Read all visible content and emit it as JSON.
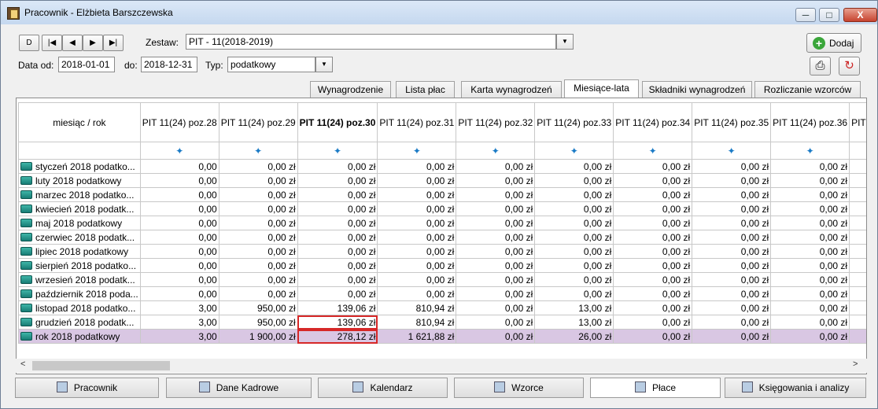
{
  "window": {
    "title": "Pracownik - Elżbieta Barszczewska",
    "minimize": "─",
    "maximize": "□",
    "close": "X"
  },
  "nav": {
    "new": "D",
    "first": "|◀",
    "prev": "◀",
    "next": "▶",
    "last": "▶|"
  },
  "form": {
    "set_label": "Zestaw:",
    "set_value": "PIT - 11(2018-2019)",
    "date_from_label": "Data od:",
    "date_from": "2018-01-01",
    "date_to_label": "do:",
    "date_to": "2018-12-31",
    "type_label": "Typ:",
    "type_value": "podatkowy",
    "dropdown_arrow": "▼"
  },
  "actions": {
    "add_label": "Dodaj",
    "add_icon": "+",
    "print_icon": "⎙",
    "refresh_icon": "↻"
  },
  "tabs": [
    "Wynagrodzenie",
    "Lista płac",
    "Karta wynagrodzeń",
    "Miesiące-lata",
    "Składniki wynagrodzeń",
    "Rozliczanie wzorców"
  ],
  "active_tab": "Miesiące-lata",
  "grid": {
    "first_header": "miesiąc / rok",
    "columns": [
      "PIT 11(24) poz.28",
      "PIT 11(24) poz.29",
      "PIT 11(24) poz.30",
      "PIT 11(24) poz.31",
      "PIT 11(24) poz.32",
      "PIT 11(24) poz.33",
      "PIT 11(24) poz.34",
      "PIT 11(24) poz.35",
      "PIT 11(24) poz.36",
      "PIT"
    ],
    "config_icon": "✦",
    "rows": [
      {
        "label": "styczeń 2018 podatko...",
        "values": [
          "0,00",
          "0,00 zł",
          "0,00 zł",
          "0,00 zł",
          "0,00 zł",
          "0,00 zł",
          "0,00 zł",
          "0,00 zł",
          "0,00 zł",
          ""
        ]
      },
      {
        "label": "luty 2018 podatkowy",
        "values": [
          "0,00",
          "0,00 zł",
          "0,00 zł",
          "0,00 zł",
          "0,00 zł",
          "0,00 zł",
          "0,00 zł",
          "0,00 zł",
          "0,00 zł",
          ""
        ]
      },
      {
        "label": "marzec 2018 podatko...",
        "values": [
          "0,00",
          "0,00 zł",
          "0,00 zł",
          "0,00 zł",
          "0,00 zł",
          "0,00 zł",
          "0,00 zł",
          "0,00 zł",
          "0,00 zł",
          ""
        ]
      },
      {
        "label": "kwiecień 2018 podatk...",
        "values": [
          "0,00",
          "0,00 zł",
          "0,00 zł",
          "0,00 zł",
          "0,00 zł",
          "0,00 zł",
          "0,00 zł",
          "0,00 zł",
          "0,00 zł",
          ""
        ]
      },
      {
        "label": "maj 2018 podatkowy",
        "values": [
          "0,00",
          "0,00 zł",
          "0,00 zł",
          "0,00 zł",
          "0,00 zł",
          "0,00 zł",
          "0,00 zł",
          "0,00 zł",
          "0,00 zł",
          ""
        ]
      },
      {
        "label": "czerwiec 2018 podatk...",
        "values": [
          "0,00",
          "0,00 zł",
          "0,00 zł",
          "0,00 zł",
          "0,00 zł",
          "0,00 zł",
          "0,00 zł",
          "0,00 zł",
          "0,00 zł",
          ""
        ]
      },
      {
        "label": "lipiec 2018 podatkowy",
        "values": [
          "0,00",
          "0,00 zł",
          "0,00 zł",
          "0,00 zł",
          "0,00 zł",
          "0,00 zł",
          "0,00 zł",
          "0,00 zł",
          "0,00 zł",
          ""
        ]
      },
      {
        "label": "sierpień 2018 podatko...",
        "values": [
          "0,00",
          "0,00 zł",
          "0,00 zł",
          "0,00 zł",
          "0,00 zł",
          "0,00 zł",
          "0,00 zł",
          "0,00 zł",
          "0,00 zł",
          ""
        ]
      },
      {
        "label": "wrzesień 2018 podatk...",
        "values": [
          "0,00",
          "0,00 zł",
          "0,00 zł",
          "0,00 zł",
          "0,00 zł",
          "0,00 zł",
          "0,00 zł",
          "0,00 zł",
          "0,00 zł",
          ""
        ]
      },
      {
        "label": "październik 2018 poda...",
        "values": [
          "0,00",
          "0,00 zł",
          "0,00 zł",
          "0,00 zł",
          "0,00 zł",
          "0,00 zł",
          "0,00 zł",
          "0,00 zł",
          "0,00 zł",
          ""
        ]
      },
      {
        "label": "listopad 2018 podatko...",
        "values": [
          "3,00",
          "950,00 zł",
          "139,06 zł",
          "810,94 zł",
          "0,00 zł",
          "13,00 zł",
          "0,00 zł",
          "0,00 zł",
          "0,00 zł",
          ""
        ]
      },
      {
        "label": "grudzień 2018 podatk...",
        "values": [
          "3,00",
          "950,00 zł",
          "139,06 zł",
          "810,94 zł",
          "0,00 zł",
          "13,00 zł",
          "0,00 zł",
          "0,00 zł",
          "0,00 zł",
          ""
        ]
      },
      {
        "label": "rok 2018 podatkowy",
        "values": [
          "3,00",
          "1 900,00 zł",
          "278,12 zł",
          "1 621,88 zł",
          "0,00 zł",
          "26,00 zł",
          "0,00 zł",
          "0,00 zł",
          "0,00 zł",
          ""
        ]
      }
    ]
  },
  "scroll": {
    "left": "<",
    "right": ">"
  },
  "bottom_tabs": [
    "Pracownik",
    "Dane Kadrowe",
    "Kalendarz",
    "Wzorce",
    "Płace",
    "Księgowania i analizy"
  ],
  "active_bottom_tab": "Płace",
  "colors": {
    "total_row": "#d9c7e3",
    "selection": "#d62828",
    "add_green": "#3aa63a"
  }
}
